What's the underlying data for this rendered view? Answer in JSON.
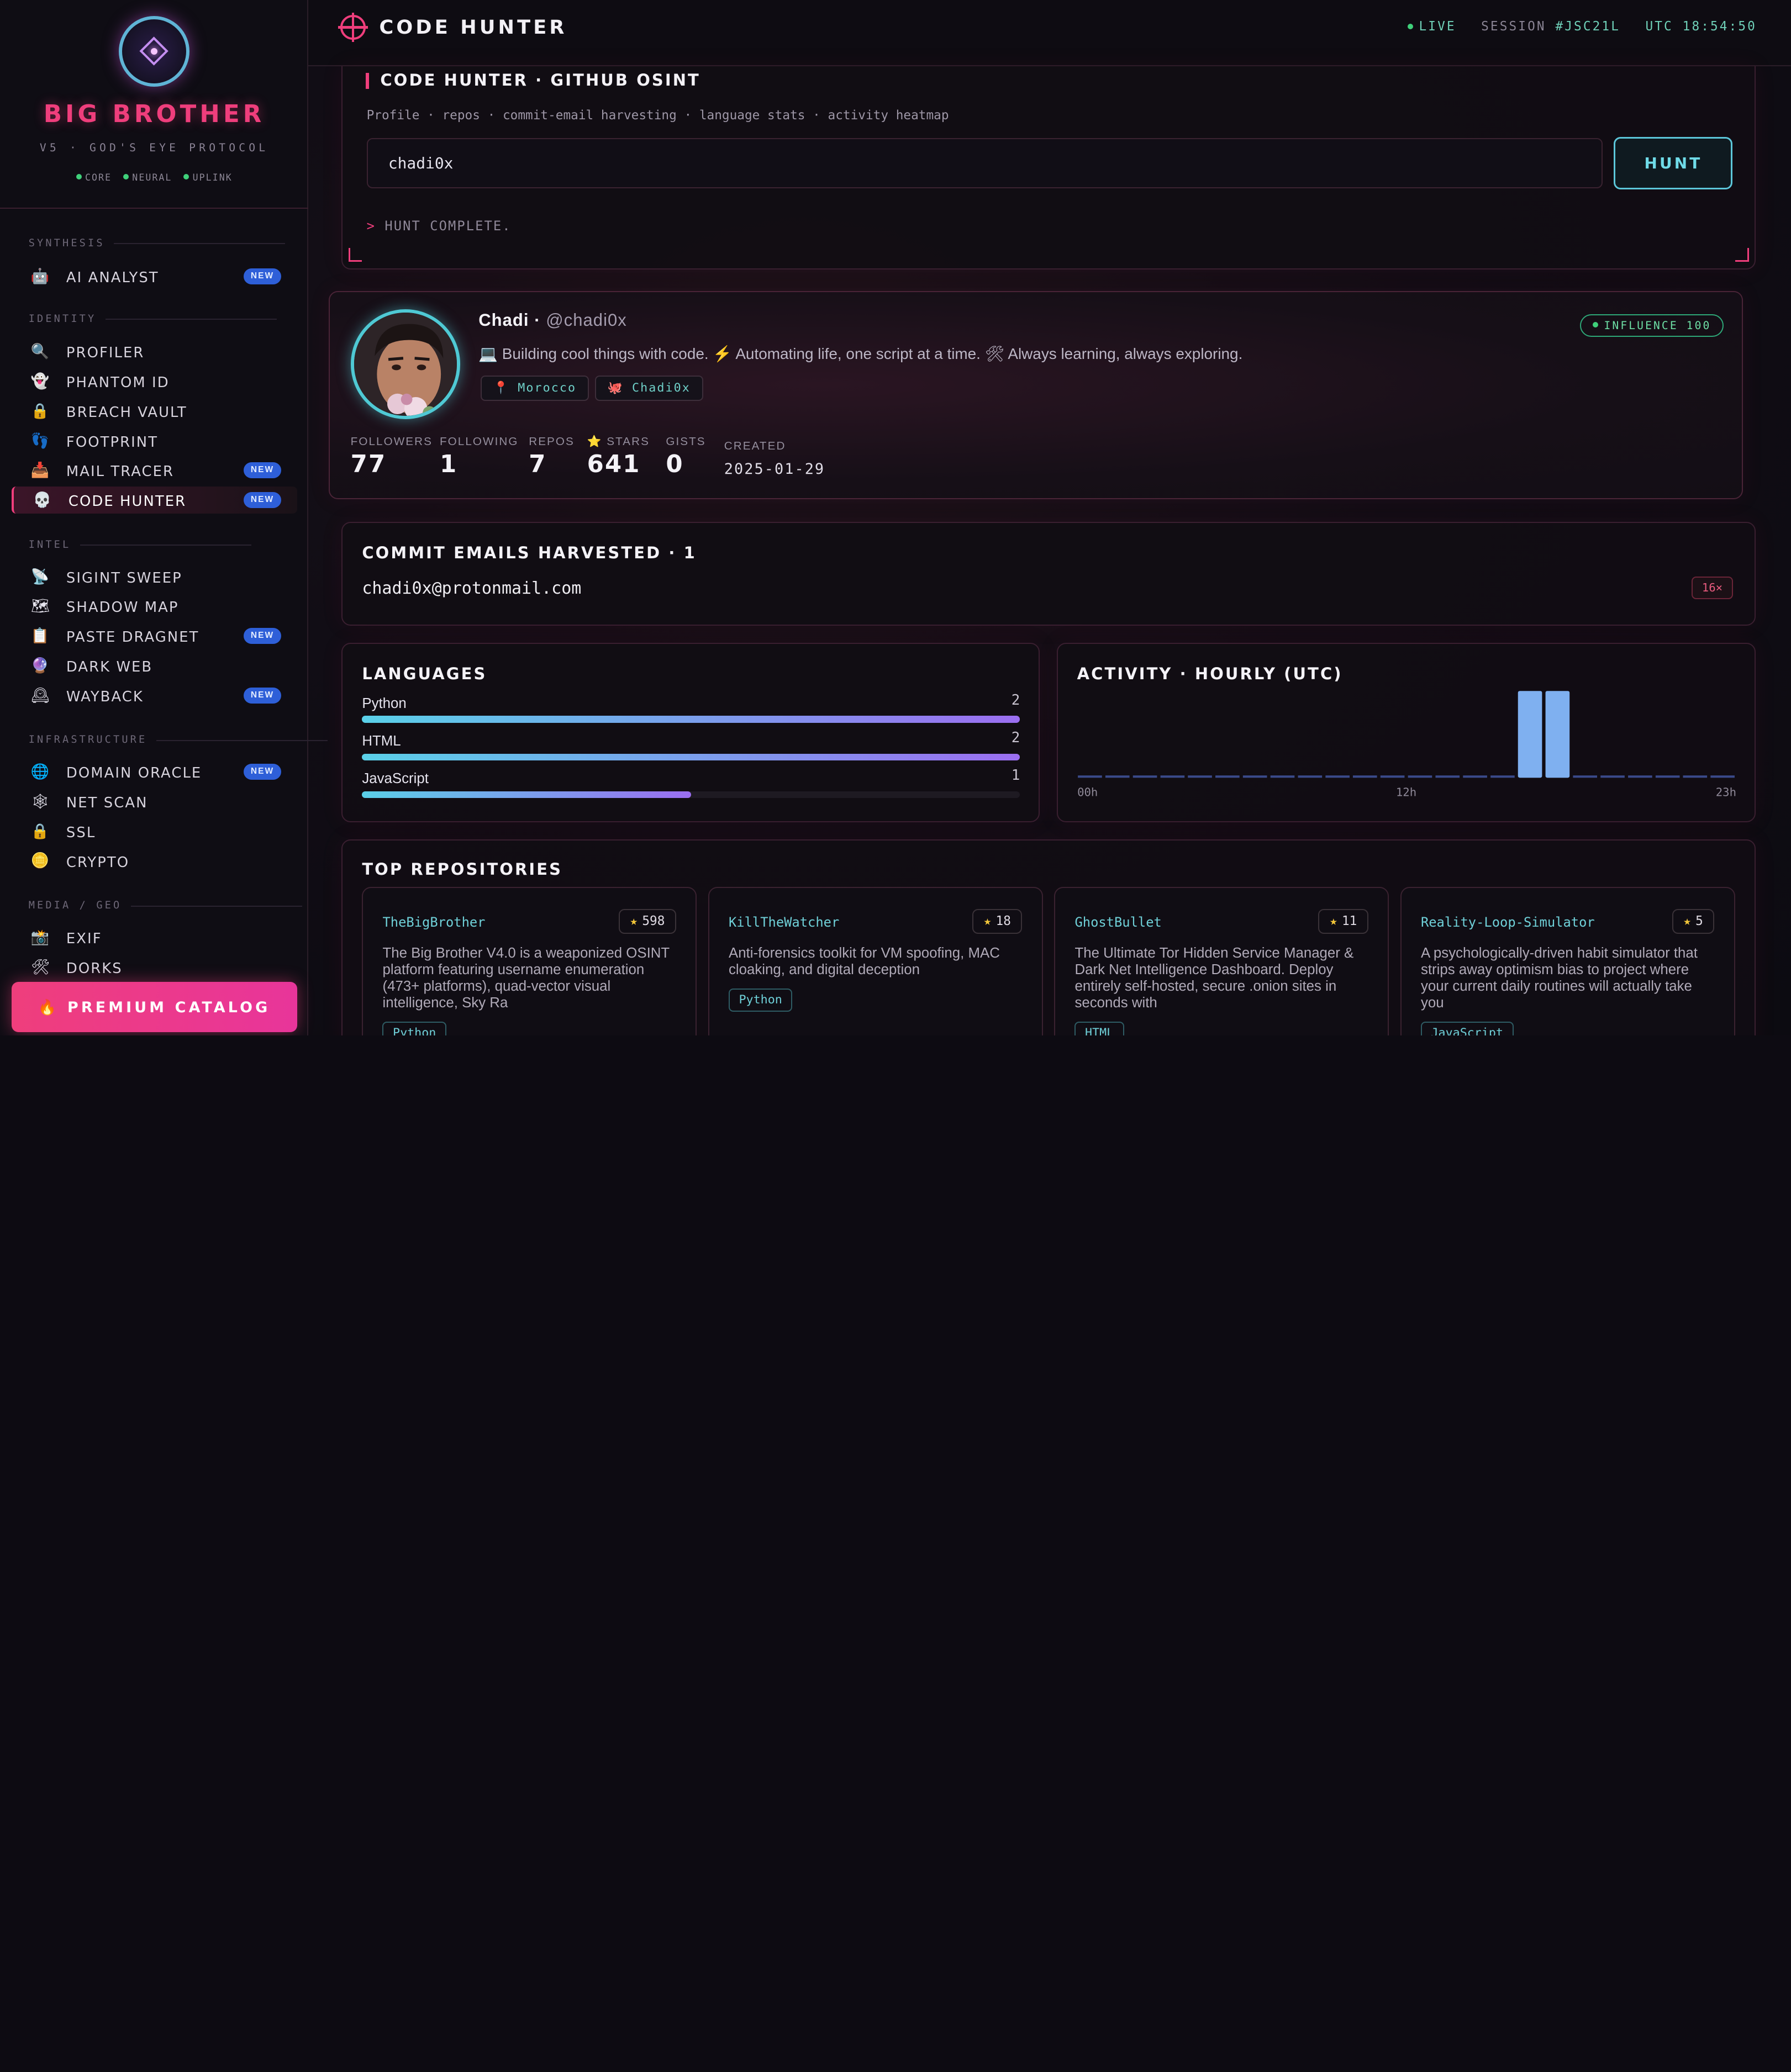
{
  "brand": {
    "title": "BIG BROTHER",
    "subtitle": "V5 · GOD'S EYE PROTOCOL",
    "status": [
      "CORE",
      "NEURAL",
      "UPLINK"
    ]
  },
  "nav": {
    "sections": [
      {
        "label": "SYNTHESIS",
        "items": [
          {
            "label": "AI ANALYST",
            "icon": "robot-icon",
            "glyph": "🤖",
            "badge": "NEW"
          }
        ]
      },
      {
        "label": "IDENTITY",
        "items": [
          {
            "label": "PROFILER",
            "icon": "magnifier-icon",
            "glyph": "🔍",
            "badge": ""
          },
          {
            "label": "PHANTOM ID",
            "icon": "ghost-icon",
            "glyph": "👻",
            "badge": ""
          },
          {
            "label": "BREACH VAULT",
            "icon": "lock-icon",
            "glyph": "🔒",
            "badge": ""
          },
          {
            "label": "FOOTPRINT",
            "icon": "footprints-icon",
            "glyph": "👣",
            "badge": ""
          },
          {
            "label": "MAIL TRACER",
            "icon": "inbox-icon",
            "glyph": "📥",
            "badge": "NEW"
          },
          {
            "label": "CODE HUNTER",
            "icon": "skull-icon",
            "glyph": "💀",
            "badge": "NEW",
            "active": true
          }
        ]
      },
      {
        "label": "INTEL",
        "items": [
          {
            "label": "SIGINT SWEEP",
            "icon": "satellite-icon",
            "glyph": "📡",
            "badge": ""
          },
          {
            "label": "SHADOW MAP",
            "icon": "map-icon",
            "glyph": "🗺",
            "badge": ""
          },
          {
            "label": "PASTE DRAGNET",
            "icon": "clipboard-icon",
            "glyph": "📋",
            "badge": "NEW"
          },
          {
            "label": "DARK WEB",
            "icon": "orb-icon",
            "glyph": "🔮",
            "badge": ""
          },
          {
            "label": "WAYBACK",
            "icon": "clock-icon",
            "glyph": "🕰",
            "badge": "NEW"
          }
        ]
      },
      {
        "label": "INFRASTRUCTURE",
        "items": [
          {
            "label": "DOMAIN ORACLE",
            "icon": "globe-icon",
            "glyph": "🌐",
            "badge": "NEW"
          },
          {
            "label": "NET SCAN",
            "icon": "network-icon",
            "glyph": "🕸",
            "badge": ""
          },
          {
            "label": "SSL",
            "icon": "padlock-icon",
            "glyph": "🔒",
            "badge": ""
          },
          {
            "label": "CRYPTO",
            "icon": "coin-icon",
            "glyph": "🪙",
            "badge": ""
          }
        ]
      },
      {
        "label": "MEDIA / GEO",
        "items": [
          {
            "label": "EXIF",
            "icon": "camera-icon",
            "glyph": "📸",
            "badge": ""
          },
          {
            "label": "DORKS",
            "icon": "tools-icon",
            "glyph": "🛠",
            "badge": ""
          }
        ]
      }
    ],
    "premium_label": "🔥 PREMIUM CATALOG"
  },
  "topbar": {
    "title": "CODE HUNTER",
    "live": "LIVE",
    "session_label": "SESSION",
    "session_id": "#JSC21L",
    "utc_label": "UTC",
    "utc_time": "18:54:50"
  },
  "hunt": {
    "title": "CODE HUNTER · GITHUB OSINT",
    "description": "Profile · repos · commit-email harvesting · language stats · activity heatmap",
    "input_value": "chadi0x",
    "button_label": "HUNT",
    "status_prefix": ">",
    "status": "HUNT COMPLETE."
  },
  "profile": {
    "name": "Chadi",
    "separator": " · ",
    "handle": "@chadi0x",
    "bio": "💻 Building cool things with code. ⚡ Automating life, one script at a time. 🛠 Always learning, always exploring.",
    "tags": [
      {
        "label": "📍 Morocco"
      },
      {
        "label": "🐙 Chadi0x"
      }
    ],
    "influence": "INFLUENCE 100",
    "stats": [
      {
        "label": "FOLLOWERS",
        "value": "77"
      },
      {
        "label": "FOLLOWING",
        "value": "1"
      },
      {
        "label": "REPOS",
        "value": "7"
      },
      {
        "label": "⭐ STARS",
        "value": "641"
      },
      {
        "label": "GISTS",
        "value": "0"
      },
      {
        "label": "CREATED",
        "value": "2025-01-29"
      }
    ]
  },
  "emails": {
    "title": "COMMIT EMAILS HARVESTED · 1",
    "items": [
      {
        "address": "chadi0x@protonmail.com",
        "count": "16×"
      }
    ]
  },
  "languages": {
    "title": "LANGUAGES",
    "items": [
      {
        "name": "Python",
        "count": "2",
        "fraction": 1.0
      },
      {
        "name": "HTML",
        "count": "2",
        "fraction": 1.0
      },
      {
        "name": "JavaScript",
        "count": "1",
        "fraction": 0.5
      }
    ]
  },
  "activity": {
    "title": "ACTIVITY · HOURLY (UTC)",
    "x_start": "00h",
    "x_mid": "12h",
    "x_end": "23h"
  },
  "chart_data": {
    "type": "bar",
    "categories": [
      "00h",
      "01h",
      "02h",
      "03h",
      "04h",
      "05h",
      "06h",
      "07h",
      "08h",
      "09h",
      "10h",
      "11h",
      "12h",
      "13h",
      "14h",
      "15h",
      "16h",
      "17h",
      "18h",
      "19h",
      "20h",
      "21h",
      "22h",
      "23h"
    ],
    "values": [
      0,
      0,
      0,
      0,
      0,
      0,
      0,
      0,
      0,
      0,
      0,
      0,
      0,
      0,
      0,
      0,
      1,
      1,
      0,
      0,
      0,
      0,
      0,
      0
    ],
    "title": "ACTIVITY · HOURLY (UTC)",
    "ylim": [
      0,
      1
    ],
    "colors": {
      "active": "#7fb0f0",
      "idle": "#3a4a8a"
    }
  },
  "repos": {
    "title": "TOP REPOSITORIES",
    "items": [
      {
        "name": "TheBigBrother",
        "stars": "598",
        "description": "The Big Brother V4.0 is a weaponized OSINT platform featuring username enumeration (473+ platforms), quad-vector visual intelligence, Sky Ra",
        "language": "Python"
      },
      {
        "name": "KillTheWatcher",
        "stars": "18",
        "description": "Anti-forensics toolkit for VM spoofing, MAC cloaking, and digital deception",
        "language": "Python"
      },
      {
        "name": "GhostBullet",
        "stars": "11",
        "description": "The Ultimate Tor Hidden Service Manager & Dark Net Intelligence Dashboard. Deploy entirely self-hosted, secure .onion sites in seconds with",
        "language": "HTML"
      },
      {
        "name": "Reality-Loop-Simulator",
        "stars": "5",
        "description": "A psychologically-driven habit simulator that strips away optimism bias to project where your current daily routines will actually take you",
        "language": "JavaScript"
      }
    ]
  },
  "colors": {
    "accent": "#ef3e7c",
    "cyan": "#5cc6d9",
    "badge": "#2e5fd8",
    "online": "#3fd07a"
  }
}
